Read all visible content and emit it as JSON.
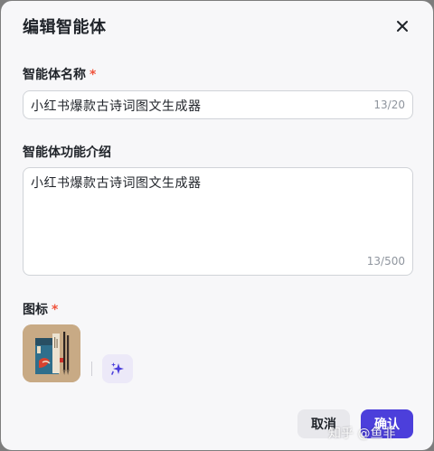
{
  "dialog": {
    "title": "编辑智能体",
    "close_icon": "close-icon"
  },
  "name_field": {
    "label": "智能体名称",
    "required_mark": "*",
    "value": "小红书爆款古诗词图文生成器",
    "counter": "13/20"
  },
  "intro_field": {
    "label": "智能体功能介绍",
    "value": "小红书爆款古诗词图文生成器",
    "counter": "13/500"
  },
  "icon_field": {
    "label": "图标",
    "required_mark": "*",
    "image_icon": "book-cover-thumbnail",
    "ai_button_icon": "sparkle-icon"
  },
  "footer": {
    "cancel_label": "取消",
    "confirm_label": "确认"
  },
  "watermark": "知乎 @鱼非",
  "colors": {
    "accent": "#4c3fdb",
    "required": "#f0533c",
    "ai_button_bg": "#ece9f8"
  }
}
